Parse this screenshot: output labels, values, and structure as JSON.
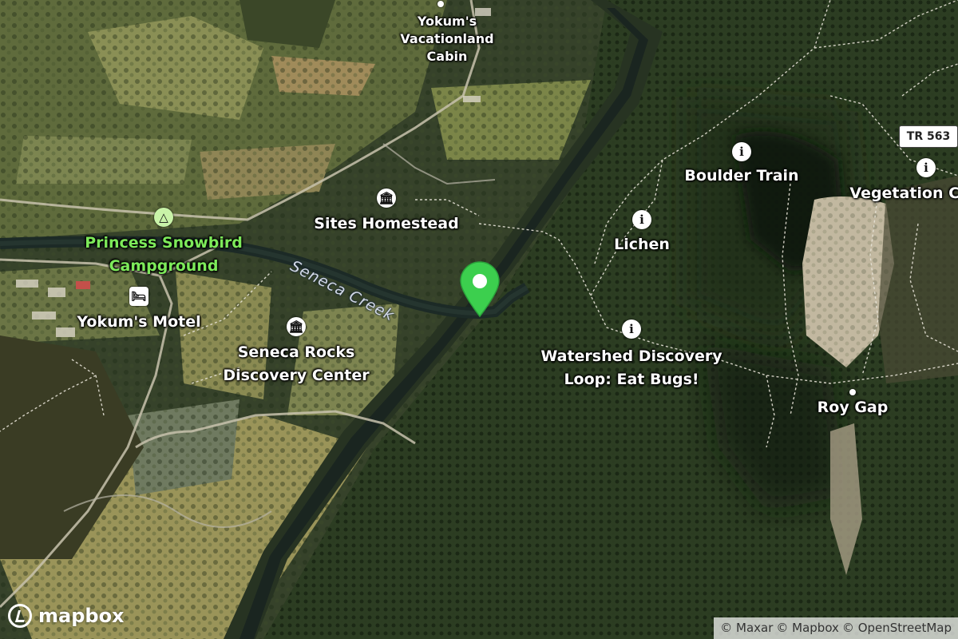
{
  "map": {
    "creek_label": "Seneca Creek",
    "road_shield": "TR 563",
    "labels": {
      "yokums_cabin": [
        "Yokum's",
        "Vacationland",
        "Cabin"
      ],
      "sites_homestead": "Sites Homestead",
      "princess_snowbird": [
        "Princess Snowbird",
        "Campground"
      ],
      "yokums_motel": "Yokum's Motel",
      "discovery_center": [
        "Seneca Rocks",
        "Discovery Center"
      ],
      "boulder_train": "Boulder Train",
      "vegetation": "Vegetation Ch",
      "lichen": "Lichen",
      "watershed": [
        "Watershed Discovery",
        "Loop: Eat Bugs!"
      ],
      "roy_gap": "Roy Gap"
    },
    "icons": {
      "museum": "museum-icon",
      "info": "info-icon",
      "campsite": "campsite-icon",
      "lodging": "bed-icon",
      "pin": "location-pin-icon"
    },
    "colors": {
      "pin": "#3ccf4e",
      "campground_text": "#7dea5a"
    }
  },
  "branding": {
    "logo_text": "mapbox"
  },
  "attribution": {
    "maxar": "© Maxar",
    "mapbox": "© Mapbox",
    "osm": "© OpenStreetMap"
  }
}
